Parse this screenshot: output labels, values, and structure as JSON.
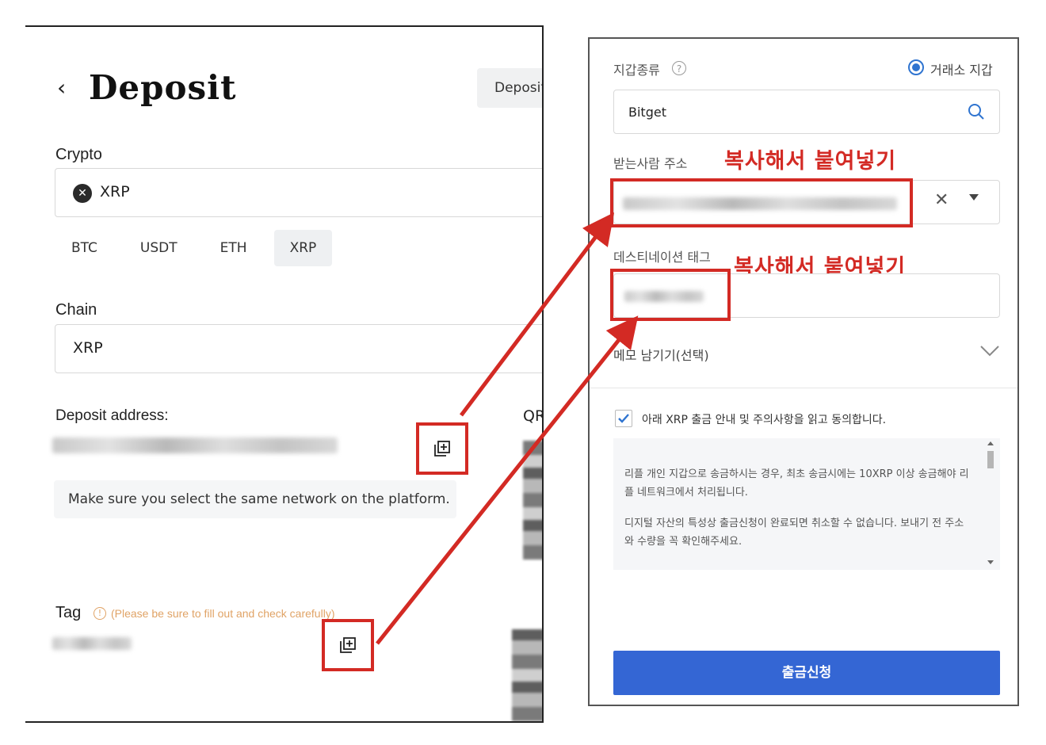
{
  "left": {
    "title": "Deposit",
    "deposit_tab": "Deposit",
    "crypto_label": "Crypto",
    "crypto_value": "XRP",
    "chips": [
      "BTC",
      "USDT",
      "ETH",
      "XRP"
    ],
    "selected_chip": "XRP",
    "chain_label": "Chain",
    "chain_value": "XRP",
    "deposit_address_label": "Deposit address:",
    "qr_label": "QR",
    "network_notice": "Make sure you select the same network on the platform.",
    "tag_label": "Tag",
    "tag_warning": "(Please be sure to fill out and check carefully)"
  },
  "right": {
    "wallet_type_label": "지갑종류",
    "exchange_wallet_label": "거래소 지갑",
    "exchange_value": "Bitget",
    "recipient_label": "받는사람 주소",
    "copy_paste_note_1": "복사해서 붙여넣기",
    "destination_tag_label": "데스티네이션 태그",
    "copy_paste_note_2": "복사해서 붙여넣기",
    "memo_label": "메모 남기기(선택)",
    "agree_text": "아래 XRP 출금 안내 및 주의사항을 읽고 동의합니다.",
    "notice_1": "리플 개인 지갑으로 송금하시는 경우, 최초 송금시에는 10XRP 이상 송금해야 리플 네트워크에서 처리됩니다.",
    "notice_2": "디지털 자산의 특성상 출금신청이 완료되면 취소할 수 없습니다. 보내기 전 주소와 수량을 꼭 확인해주세요.",
    "submit_label": "출금신청"
  },
  "colors": {
    "annotation_red": "#d32a24",
    "submit_blue": "#3466d4",
    "radio_blue": "#2f74d0",
    "tag_warning_orange": "#e0a366"
  }
}
